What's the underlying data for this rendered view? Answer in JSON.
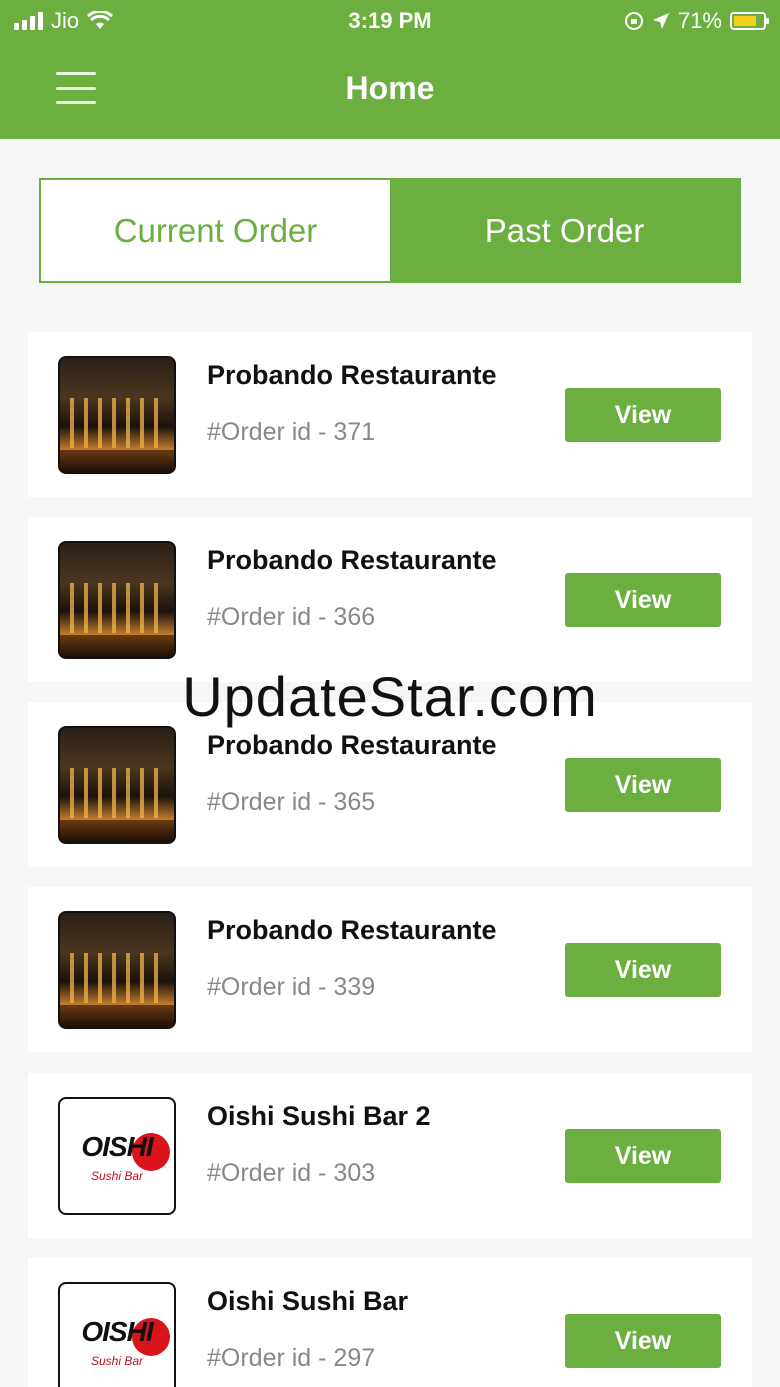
{
  "status_bar": {
    "carrier": "Jio",
    "time": "3:19 PM",
    "battery": "71%"
  },
  "header": {
    "title": "Home"
  },
  "tabs": [
    {
      "label": "Current Order"
    },
    {
      "label": "Past Order"
    }
  ],
  "orders": [
    {
      "restaurant": "Probando Restaurante",
      "order_id": "#Order id - 371",
      "button": "View",
      "thumb": "restaurant-interior"
    },
    {
      "restaurant": "Probando Restaurante",
      "order_id": "#Order id - 366",
      "button": "View",
      "thumb": "restaurant-interior"
    },
    {
      "restaurant": "Probando Restaurante",
      "order_id": "#Order id - 365",
      "button": "View",
      "thumb": "restaurant-interior"
    },
    {
      "restaurant": "Probando Restaurante",
      "order_id": "#Order id - 339",
      "button": "View",
      "thumb": "restaurant-interior"
    },
    {
      "restaurant": "Oishi Sushi Bar 2",
      "order_id": "#Order id - 303",
      "button": "View",
      "thumb": "oishi-logo"
    },
    {
      "restaurant": "Oishi Sushi Bar",
      "order_id": "#Order id - 297",
      "button": "View",
      "thumb": "oishi-logo"
    }
  ],
  "oishi_logo": {
    "text": "OISHI",
    "sub": "Sushi Bar"
  },
  "watermark": "UpdateStar.com",
  "colors": {
    "accent": "#6aaf3f",
    "background": "#f6f6f6"
  }
}
